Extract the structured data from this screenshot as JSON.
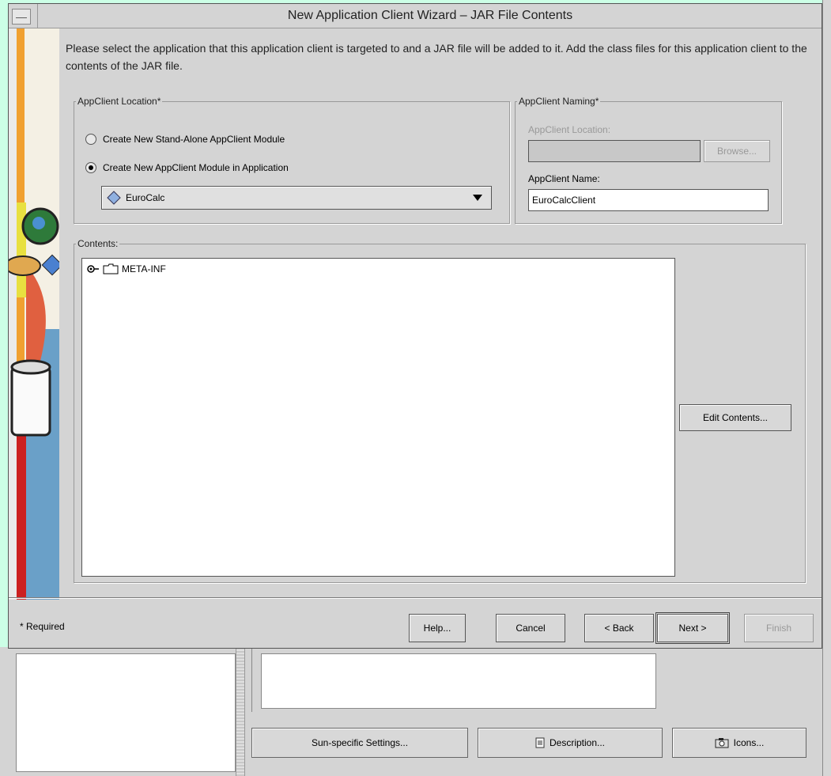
{
  "dialog": {
    "title": "New Application Client Wizard – JAR File Contents",
    "instructions": "Please select the application that this application client is targeted to and a JAR file will be added to it. Add the class files for this application client to the contents of the JAR file."
  },
  "location": {
    "legend": "AppClient Location*",
    "option_standalone": "Create New Stand-Alone AppClient Module",
    "option_in_app": "Create New AppClient Module in Application",
    "selected": "option_in_app",
    "application_value": "EuroCalc"
  },
  "naming": {
    "legend": "AppClient Naming*",
    "location_label": "AppClient Location:",
    "location_value": "",
    "browse": "Browse...",
    "name_label": "AppClient Name:",
    "name_value": "EuroCalcClient"
  },
  "contents": {
    "legend": "Contents:",
    "tree_items": [
      "META-INF"
    ],
    "edit_button": "Edit Contents..."
  },
  "footer": {
    "required_note": "* Required",
    "help": "Help...",
    "cancel": "Cancel",
    "back": "< Back",
    "next": "Next >",
    "finish": "Finish"
  },
  "background": {
    "sun_settings": "Sun-specific Settings...",
    "description": "Description...",
    "icons": "Icons..."
  }
}
